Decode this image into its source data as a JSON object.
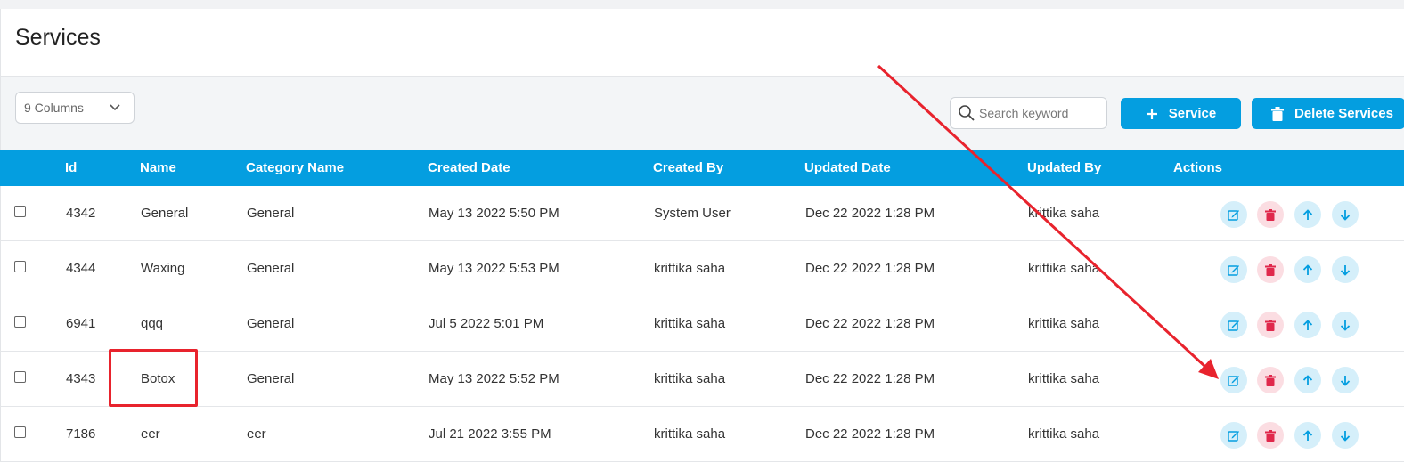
{
  "page": {
    "title": "Services"
  },
  "toolbar": {
    "columns_select": "9 Columns",
    "search_placeholder": "Search keyword",
    "add_service_label": "Service",
    "delete_services_label": "Delete Services"
  },
  "table": {
    "headers": {
      "id": "Id",
      "name": "Name",
      "category": "Category Name",
      "created_date": "Created Date",
      "created_by": "Created By",
      "updated_date": "Updated Date",
      "updated_by": "Updated By",
      "actions": "Actions"
    },
    "rows": [
      {
        "id": "4342",
        "name": "General",
        "category": "General",
        "created_date": "May 13 2022 5:50 PM",
        "created_by": "System User",
        "updated_date": "Dec 22 2022 1:28 PM",
        "updated_by": "krittika saha"
      },
      {
        "id": "4344",
        "name": "Waxing",
        "category": "General",
        "created_date": "May 13 2022 5:53 PM",
        "created_by": "krittika saha",
        "updated_date": "Dec 22 2022 1:28 PM",
        "updated_by": "krittika saha"
      },
      {
        "id": "6941",
        "name": "qqq",
        "category": "General",
        "created_date": "Jul 5 2022 5:01 PM",
        "created_by": "krittika saha",
        "updated_date": "Dec 22 2022 1:28 PM",
        "updated_by": "krittika saha"
      },
      {
        "id": "4343",
        "name": "Botox",
        "category": "General",
        "created_date": "May 13 2022 5:52 PM",
        "created_by": "krittika saha",
        "updated_date": "Dec 22 2022 1:28 PM",
        "updated_by": "krittika saha"
      },
      {
        "id": "7186",
        "name": "eer",
        "category": "eer",
        "created_date": "Jul 21 2022 3:55 PM",
        "created_by": "krittika saha",
        "updated_date": "Dec 22 2022 1:28 PM",
        "updated_by": "krittika saha"
      }
    ]
  },
  "icons": {
    "columns_select": "chevron-down-icon",
    "search": "search-icon",
    "add": "plus-icon",
    "delete_services": "trash-icon",
    "row_actions": [
      "edit-icon",
      "trash-icon",
      "arrow-up-icon",
      "arrow-down-icon"
    ]
  },
  "colors": {
    "accent": "#049ee0",
    "header_text": "#ffffff",
    "action_blue_bg": "#d5effa",
    "action_red_bg": "#fbdde2",
    "delete_red": "#e0284b",
    "annotation_red": "#e8232d"
  }
}
